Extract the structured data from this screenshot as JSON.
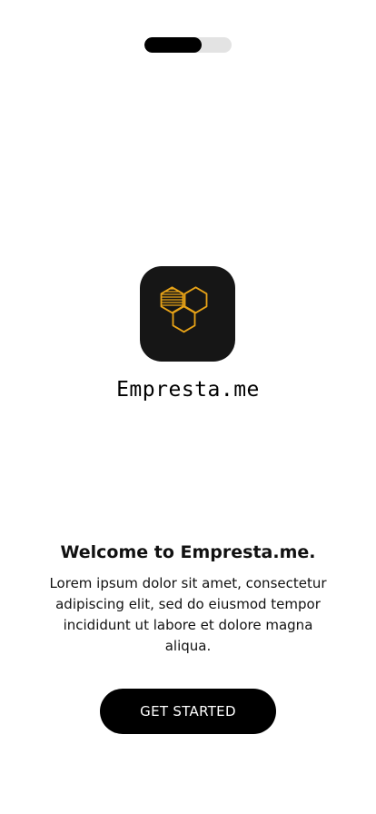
{
  "onboarding": {
    "progress": 0.66
  },
  "brand": {
    "logo_icon": "honeycomb-icon",
    "logo_color": "#e8a317",
    "tile_color": "#161616",
    "app_name": "Empresta.me"
  },
  "welcome": {
    "title": "Welcome to Empresta.me.",
    "body": "Lorem ipsum dolor sit amet, consectetur adipiscing elit, sed do eiusmod tempor incididunt ut labore et dolore magna aliqua."
  },
  "actions": {
    "get_started_label": "GET STARTED"
  }
}
